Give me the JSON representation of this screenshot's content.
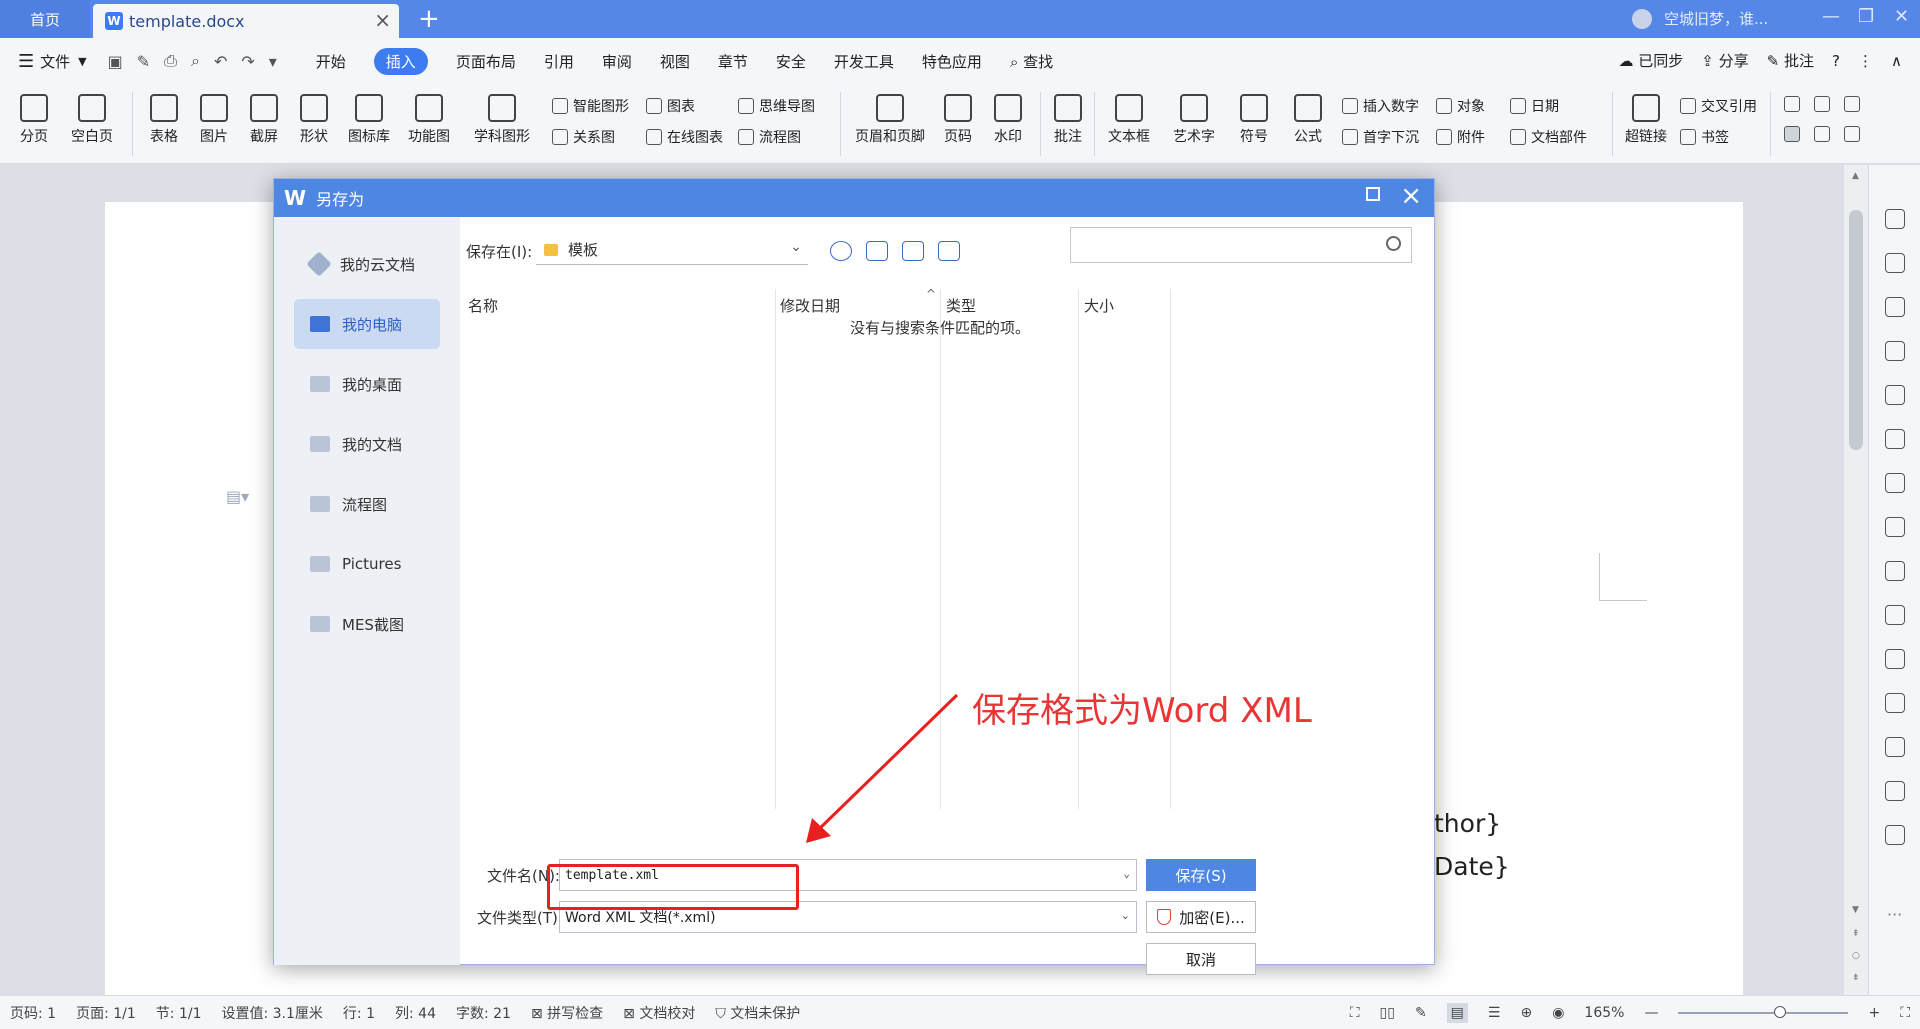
{
  "titlebar": {
    "home_tab": "首页",
    "doc_tab": "template.docx",
    "user": "空城旧梦，谁..."
  },
  "menubar": {
    "file": "文件",
    "tabs": [
      "开始",
      "插入",
      "页面布局",
      "引用",
      "审阅",
      "视图",
      "章节",
      "安全",
      "开发工具",
      "特色应用"
    ],
    "active_tab": "插入",
    "search": "查找",
    "sync": "已同步",
    "share": "分享",
    "comment": "批注"
  },
  "ribbon": {
    "page_break": "分页",
    "blank_page": "空白页",
    "table": "表格",
    "picture": "图片",
    "screenshot": "截屏",
    "shape": "形状",
    "icon_lib": "图标库",
    "function_chart": "功能图",
    "smart_shape": "智能图形",
    "chart": "图表",
    "mindmap": "思维导图",
    "relation": "关系图",
    "online_chart": "在线图表",
    "flowchart": "流程图",
    "subject_shape": "学科图形",
    "header_footer": "页眉和页脚",
    "page_number": "页码",
    "watermark": "水印",
    "comment": "批注",
    "textbox": "文本框",
    "wordart": "艺术字",
    "symbol": "符号",
    "formula": "公式",
    "insert_number": "插入数字",
    "object": "对象",
    "date": "日期",
    "drop_cap": "首字下沉",
    "attachment": "附件",
    "doc_parts": "文档部件",
    "hyperlink": "超链接",
    "cross_ref": "交叉引用",
    "bookmark": "书签"
  },
  "document": {
    "line1": "thor}",
    "line2": "Date}"
  },
  "dialog": {
    "title": "另存为",
    "sidebar": [
      "我的云文档",
      "我的电脑",
      "我的桌面",
      "我的文档",
      "流程图",
      "Pictures",
      "MES截图"
    ],
    "active_sidebar": "我的电脑",
    "save_in_label": "保存在(I):",
    "save_in_value": "模板",
    "columns": [
      "名称",
      "修改日期",
      "类型",
      "大小"
    ],
    "empty_message": "没有与搜索条件匹配的项。",
    "filename_label": "文件名(N):",
    "filename_value": "template.xml",
    "filetype_label": "文件类型(T):",
    "filetype_value": "Word XML 文档(*.xml)",
    "save_button": "保存(S)",
    "encrypt_button": "加密(E)...",
    "cancel_button": "取消"
  },
  "annotation": {
    "text": "保存格式为Word XML",
    "color": "#e83535"
  },
  "statusbar": {
    "page": "页码: 1",
    "pages": "页面: 1/1",
    "section": "节: 1/1",
    "setting": "设置值: 3.1厘米",
    "row": "行: 1",
    "col": "列: 44",
    "words": "字数: 21",
    "spell": "拼写检查",
    "proof": "文档校对",
    "protect": "文档未保护",
    "zoom": "165%"
  },
  "colors": {
    "accent": "#4e86e4",
    "annotation_red": "#e8201f"
  }
}
